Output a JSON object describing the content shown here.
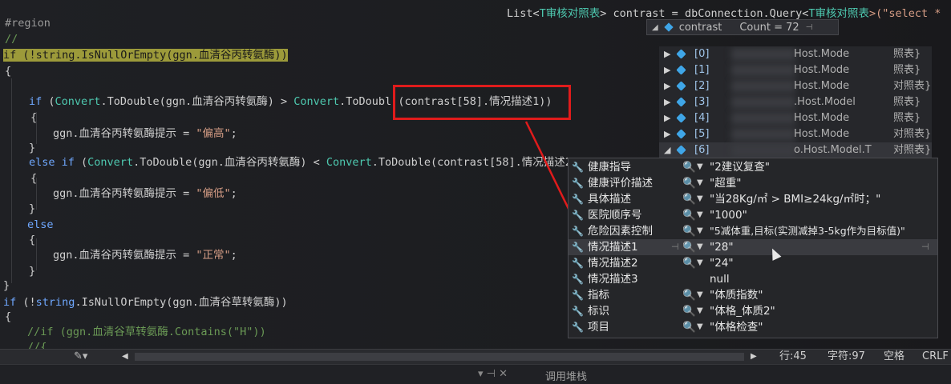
{
  "top_code": {
    "prefix": "List<",
    "type1": "T审核对照表",
    "mid": "> contrast = dbConnection.Query<",
    "type2": "T审核对照表",
    "suffix": ">(\"select *"
  },
  "code": {
    "l1": "#region",
    "l2": "//",
    "l3": "if (!string.IsNullOrEmpty(ggn.血清谷丙转氨酶))",
    "l4": "{",
    "l5a_kw": "if",
    "l5a_open": " (",
    "l5a_conv": "Convert",
    "l5a_rest": ".ToDouble(ggn.血清谷丙转氨酶) > ",
    "l5a_conv2": "Convert",
    "l5a_rest2": ".ToDoubl",
    "l5a_boxed": "(contrast[58].情况描述1))",
    "l6": "{",
    "l7a": "ggn.血清谷丙转氨酶提示 = ",
    "l7b": "\"偏高\"",
    "l7c": ";",
    "l8": "}",
    "l9_kw": "else if",
    "l9_open": " (",
    "l9_conv": "Convert",
    "l9_rest": ".ToDouble(ggn.血清谷丙转氨酶) < ",
    "l9_conv2": "Convert",
    "l9_rest2": ".ToDouble(contrast[58].情况描述2))",
    "l10": "{",
    "l11a": "ggn.血清谷丙转氨酶提示 = ",
    "l11b": "\"偏低\"",
    "l11c": ";",
    "l12": "}",
    "l13": "else",
    "l14": "{",
    "l15a": "ggn.血清谷丙转氨酶提示 = ",
    "l15b": "\"正常\"",
    "l15c": ";",
    "l16": "}",
    "l17": "}",
    "l18_kw": "if",
    "l18_rest": " (!",
    "l18_str": "string",
    "l18_rest2": ".IsNullOrEmpty(ggn.血清谷草转氨酶))",
    "l19": "{",
    "l20": "//if (ggn.血清谷草转氨酶.Contains(\"H\"))",
    "l21": "//{"
  },
  "tip": {
    "name": "contrast",
    "count": "Count = 72",
    "rows": [
      {
        "idx": "[0]",
        "val": "Host.Mode",
        "val2": "照表}"
      },
      {
        "idx": "[1]",
        "val": "Host.Mode",
        "val2": "照表}"
      },
      {
        "idx": "[2]",
        "val": "Host.Mode",
        "val2": "对照表}"
      },
      {
        "idx": "[3]",
        "val": ".Host.Model",
        "val2": "照表}"
      },
      {
        "idx": "[4]",
        "val": "Host.Mode",
        "val2": "照表}"
      },
      {
        "idx": "[5]",
        "val": "Host.Mode",
        "val2": "对照表}"
      },
      {
        "idx": "[6]",
        "val": "o.Host.Model.T",
        "val2": "对照表}"
      }
    ]
  },
  "props": [
    {
      "name": "健康指导",
      "value": "\"2建议复查\""
    },
    {
      "name": "健康评价描述",
      "value": "\"超重\""
    },
    {
      "name": "具体描述",
      "value": "\"当28Kg/㎡ > BMI≥24kg/㎡时；\""
    },
    {
      "name": "医院顺序号",
      "value": "\"1000\""
    },
    {
      "name": "危险因素控制",
      "value": "\"5减体重,目标(实测减掉3-5kg作为目标值)\""
    },
    {
      "name": "情况描述1",
      "value": "\"28\""
    },
    {
      "name": "情况描述2",
      "value": "\"24\""
    },
    {
      "name": "情况描述3",
      "value": "null"
    },
    {
      "name": "指标",
      "value": "\"体质指数\""
    },
    {
      "name": "标识",
      "value": "\"体格_体质2\""
    },
    {
      "name": "项目",
      "value": "\"体格检查\""
    }
  ],
  "status": {
    "line": "行:45",
    "col": "字符:97",
    "space": "空格",
    "crlf": "CRLF"
  },
  "bottom": {
    "tab": "调用堆栈"
  }
}
